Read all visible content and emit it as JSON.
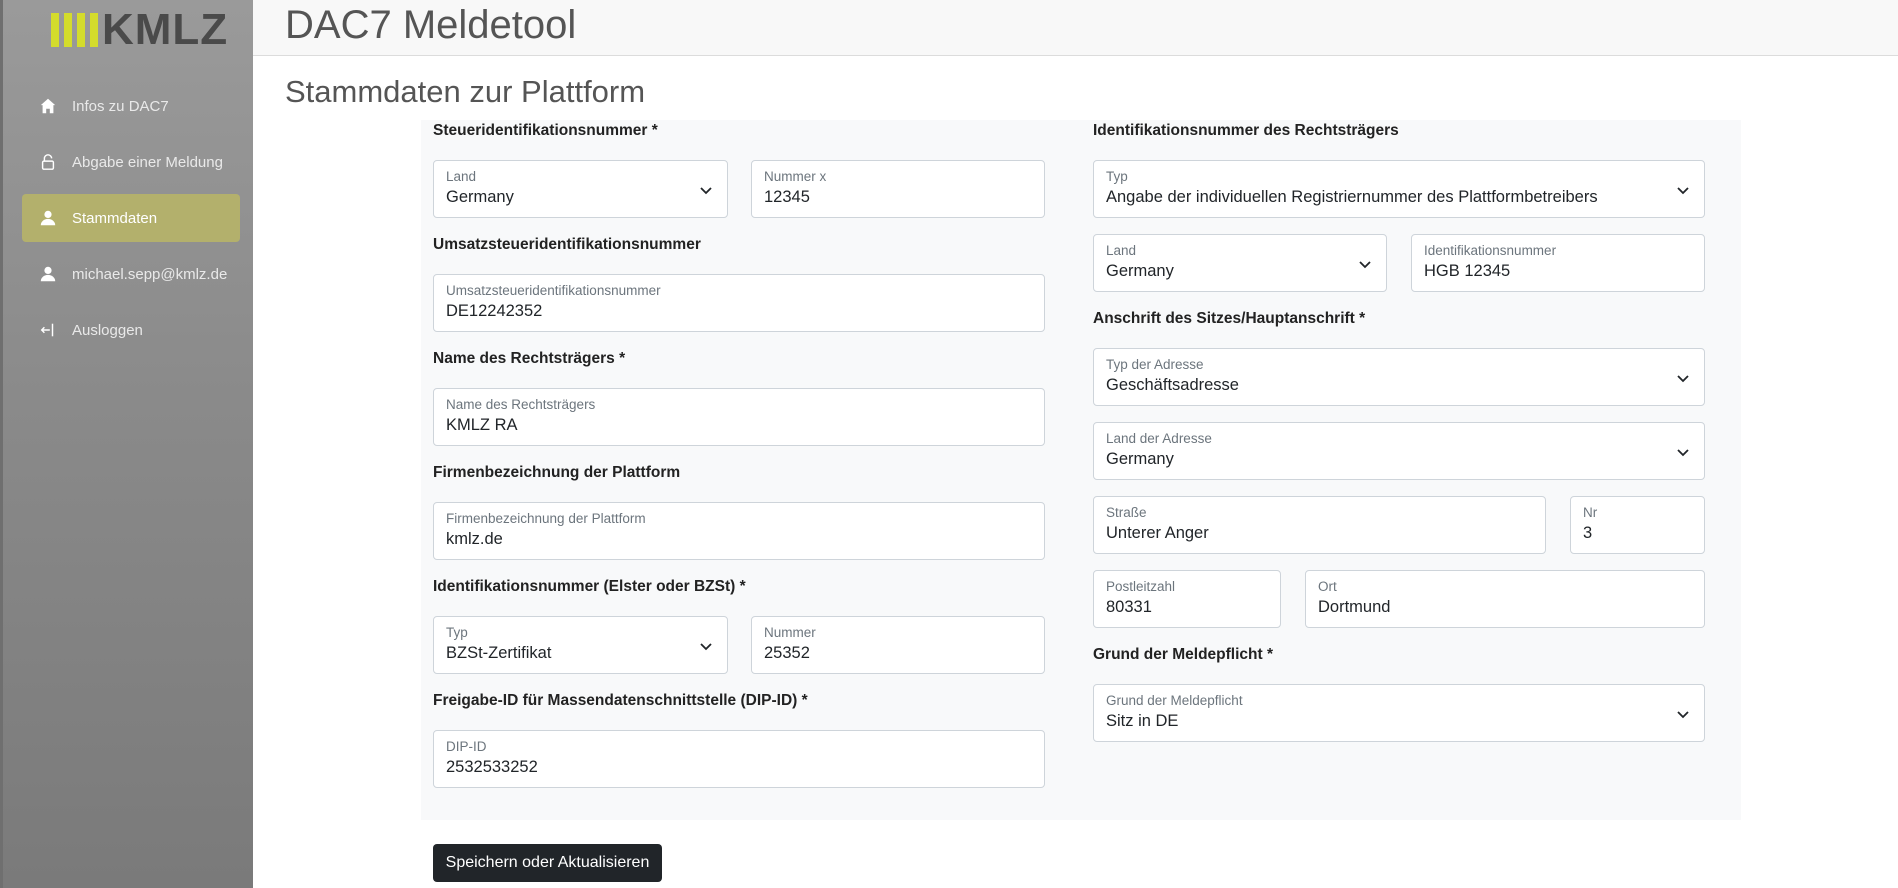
{
  "app": {
    "title": "DAC7 Meldetool"
  },
  "logo": {
    "text": "KMLZ",
    "accent_color": "#d4dc2c"
  },
  "sidebar": {
    "items": [
      {
        "label": "Infos zu DAC7",
        "icon": "home-icon"
      },
      {
        "label": "Abgabe einer Meldung",
        "icon": "lock-icon"
      },
      {
        "label": "Stammdaten",
        "icon": "user-icon",
        "active": true
      },
      {
        "label": "michael.sepp@kmlz.de",
        "icon": "user-icon"
      },
      {
        "label": "Ausloggen",
        "icon": "logout-icon"
      }
    ]
  },
  "page": {
    "title": "Stammdaten zur Plattform"
  },
  "form": {
    "steuer": {
      "heading": "Steueridentifikationsnummer *",
      "land_label": "Land",
      "land_value": "Germany",
      "nummer_label": "Nummer x",
      "nummer_value": "12345"
    },
    "ust": {
      "heading": "Umsatzsteueridentifikationsnummer",
      "label": "Umsatzsteueridentifikationsnummer",
      "value": "DE12242352"
    },
    "name": {
      "heading": "Name des Rechtsträgers *",
      "label": "Name des Rechtsträgers",
      "value": "KMLZ RA"
    },
    "firma": {
      "heading": "Firmenbezeichnung der Plattform",
      "label": "Firmenbezeichnung der Plattform",
      "value": "kmlz.de"
    },
    "elster": {
      "heading": "Identifikationsnummer (Elster oder BZSt) *",
      "typ_label": "Typ",
      "typ_value": "BZSt-Zertifikat",
      "nummer_label": "Nummer",
      "nummer_value": "25352"
    },
    "dip": {
      "heading": "Freigabe-ID für Massendatenschnittstelle (DIP-ID) *",
      "label": "DIP-ID",
      "value": "2532533252"
    },
    "rt_id": {
      "heading": "Identifikationsnummer des Rechtsträgers",
      "typ_label": "Typ",
      "typ_value": "Angabe der individuellen Registriernummer des Plattformbetreibers",
      "land_label": "Land",
      "land_value": "Germany",
      "id_label": "Identifikationsnummer",
      "id_value": "HGB 12345"
    },
    "address": {
      "heading": "Anschrift des Sitzes/Hauptanschrift *",
      "typ_label": "Typ der Adresse",
      "typ_value": "Geschäftsadresse",
      "land_label": "Land der Adresse",
      "land_value": "Germany",
      "strasse_label": "Straße",
      "strasse_value": "Unterer Anger",
      "nr_label": "Nr",
      "nr_value": "3",
      "plz_label": "Postleitzahl",
      "plz_value": "80331",
      "ort_label": "Ort",
      "ort_value": "Dortmund"
    },
    "grund": {
      "heading": "Grund der Meldepflicht *",
      "label": "Grund der Meldepflicht",
      "value": "Sitz in DE"
    },
    "save_label": "Speichern oder Aktualisieren"
  }
}
